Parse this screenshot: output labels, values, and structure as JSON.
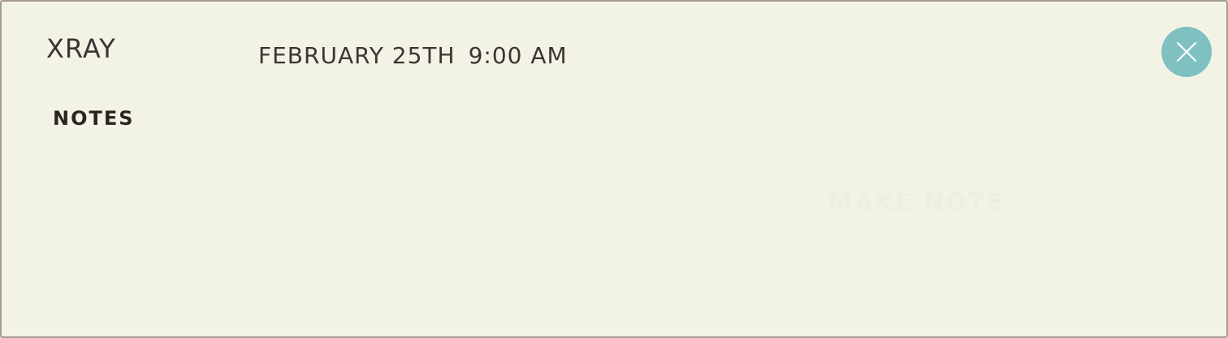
{
  "event": {
    "title": "XRAY",
    "date": "FEBRUARY 25TH",
    "time": "9:00 AM"
  },
  "notes": {
    "label": "NOTES",
    "make_note_label": "MAKE NOTE"
  },
  "close_button": {
    "icon": "close-icon"
  },
  "colors": {
    "background": "#f3f3e5",
    "border": "#a59a91",
    "accent": "#7fc0c0",
    "text": "#3d3434"
  }
}
